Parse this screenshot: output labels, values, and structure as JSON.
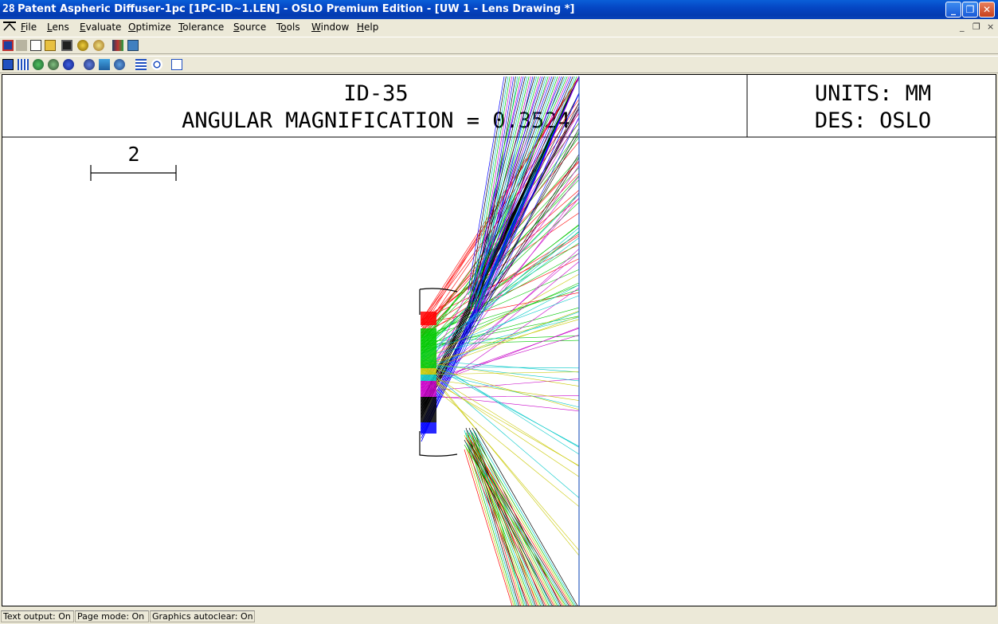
{
  "window": {
    "title": "Patent Aspheric Diffuser-1pc [1PC-ID~1.LEN] - OSLO Premium Edition - [UW 1 - Lens Drawing *]",
    "app_icon_glyph": "28"
  },
  "menu": {
    "items": [
      {
        "label": "File",
        "underline": "F"
      },
      {
        "label": "Lens",
        "underline": "L"
      },
      {
        "label": "Evaluate",
        "underline": "E"
      },
      {
        "label": "Optimize",
        "underline": "O"
      },
      {
        "label": "Tolerance",
        "underline": "T"
      },
      {
        "label": "Source",
        "underline": "S"
      },
      {
        "label": "Tools",
        "underline": "o"
      },
      {
        "label": "Window",
        "underline": "W"
      },
      {
        "label": "Help",
        "underline": "H"
      }
    ],
    "mdi_minimize": "_",
    "mdi_restore": "❐",
    "mdi_close": "×"
  },
  "toolbar1": {
    "icons": [
      "grid-icon",
      "blank-icon",
      "new-file-icon",
      "open-folder-icon",
      "save-icon",
      "lens-icon",
      "globe-icon",
      "book-icon",
      "network-icon"
    ]
  },
  "toolbar2": {
    "icons": [
      "spreadsheet-icon",
      "grid-ray-icon",
      "palette-icon",
      "sphere-icon",
      "wave-icon",
      "lens-globe-icon",
      "chart-icon",
      "sphere-blue-icon",
      "spot-icon",
      "target-icon",
      "matrix-icon"
    ]
  },
  "drawing": {
    "title_line1": "ID-35",
    "title_line2": "ANGULAR MAGNIFICATION = 0.3524",
    "units_line1": "UNITS: MM",
    "units_line2": "DES: OSLO",
    "scale_label": "2",
    "ray_colors": [
      "#ff0000",
      "#00c800",
      "#0000ff",
      "#000000",
      "#c800c8",
      "#00c8c8",
      "#c8c800"
    ]
  },
  "status": {
    "text_output": "Text output: On",
    "page_mode": "Page mode: On",
    "graphics_autoclear": "Graphics autoclear: On"
  }
}
